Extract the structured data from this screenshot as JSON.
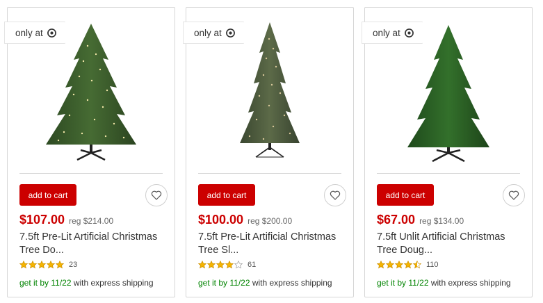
{
  "colors": {
    "accent_red": "#cc0000",
    "shipping_green": "#008300",
    "star_gold": "#f5b400",
    "border_gray": "#d6d6d6"
  },
  "products": [
    {
      "badge_text": "only at",
      "badge_icon": "target-logo-icon",
      "image": "pre-lit-christmas-tree",
      "add_to_cart_label": "add to cart",
      "favorite_icon": "heart-icon",
      "price": "$107.00",
      "reg_price": "reg $214.00",
      "title_line1": "7.5ft Pre-Lit Artificial Christmas",
      "title_line2": "Tree Do...",
      "rating": 5,
      "review_count": "23",
      "shipping_prefix": "get it by 11/22",
      "shipping_suffix": " with express shipping"
    },
    {
      "badge_text": "only at",
      "badge_icon": "target-logo-icon",
      "image": "pre-lit-slim-christmas-tree",
      "add_to_cart_label": "add to cart",
      "favorite_icon": "heart-icon",
      "price": "$100.00",
      "reg_price": "reg $200.00",
      "title_line1": "7.5ft Pre-Lit Artificial Christmas",
      "title_line2": "Tree Sl...",
      "rating": 4,
      "review_count": "61",
      "shipping_prefix": "get it by 11/22",
      "shipping_suffix": " with express shipping"
    },
    {
      "badge_text": "only at",
      "badge_icon": "target-logo-icon",
      "image": "unlit-christmas-tree",
      "add_to_cart_label": "add to cart",
      "favorite_icon": "heart-icon",
      "price": "$67.00",
      "reg_price": "reg $134.00",
      "title_line1": "7.5ft Unlit Artificial Christmas",
      "title_line2": "Tree Doug...",
      "rating": 4.5,
      "review_count": "110",
      "shipping_prefix": "get it by 11/22",
      "shipping_suffix": " with express shipping"
    }
  ]
}
